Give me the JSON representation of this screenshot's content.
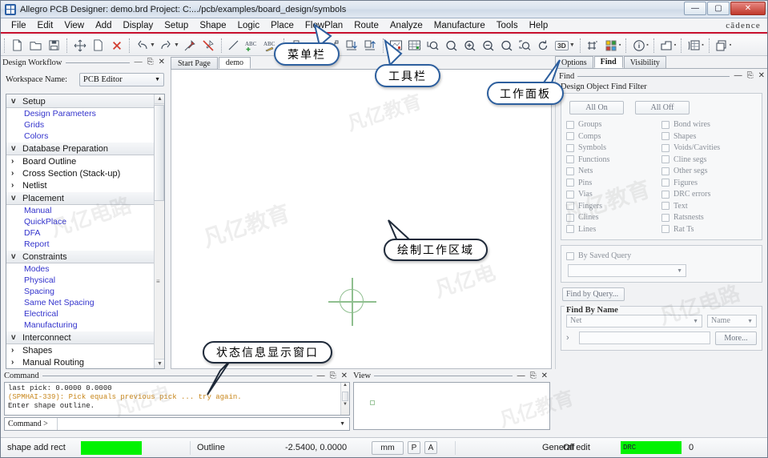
{
  "window": {
    "title": "Allegro PCB Designer: demo.brd  Project: C:.../pcb/examples/board_design/symbols",
    "minimize": "—",
    "maximize": "▢",
    "close": "✕",
    "brand": "cādence"
  },
  "menubar": {
    "items": [
      "File",
      "Edit",
      "View",
      "Add",
      "Display",
      "Setup",
      "Shape",
      "Logic",
      "Place",
      "FlowPlan",
      "Route",
      "Analyze",
      "Manufacture",
      "Tools",
      "Help"
    ]
  },
  "toolbar": {
    "icons": [
      "new-file-icon",
      "open-folder-icon",
      "save-icon",
      "move-icon",
      "copy-icon",
      "delete-icon",
      "undo-icon",
      "redo-icon",
      "pin-icon",
      "unpin-icon",
      "line-icon",
      "add-text-icon",
      "edit-text-icon",
      "component-icon",
      "placement-edit-icon",
      "dimension-icon",
      "import-icon",
      "export-icon",
      "datatips-icon",
      "grid-toggle-icon",
      "zoom-by-points-icon",
      "zoom-fit-icon",
      "zoom-in-icon",
      "zoom-out-icon",
      "zoom-previous-icon",
      "zoom-region-icon",
      "refresh-icon",
      "3d-view-icon",
      "grid-icon",
      "color-palette-icon",
      "info-icon",
      "shape-icon",
      "table-icon",
      "copy-window-icon"
    ],
    "label_3d": "3D"
  },
  "design_workflow": {
    "caption": "Design Workflow",
    "workspace_label": "Workspace Name:",
    "workspace_value": "PCB Editor",
    "tree": [
      {
        "type": "group",
        "label": "Setup",
        "twisty": "v"
      },
      {
        "type": "leaf",
        "label": "Design Parameters"
      },
      {
        "type": "leaf",
        "label": "Grids"
      },
      {
        "type": "leaf",
        "label": "Colors"
      },
      {
        "type": "group",
        "label": "Database Preparation",
        "twisty": "v"
      },
      {
        "type": "node",
        "label": "Board Outline",
        "twisty": "›"
      },
      {
        "type": "node",
        "label": "Cross Section (Stack-up)",
        "twisty": "›"
      },
      {
        "type": "node",
        "label": "Netlist",
        "twisty": "›"
      },
      {
        "type": "group",
        "label": "Placement",
        "twisty": "v"
      },
      {
        "type": "leaf",
        "label": "Manual"
      },
      {
        "type": "leaf",
        "label": "QuickPlace"
      },
      {
        "type": "leaf",
        "label": "DFA"
      },
      {
        "type": "leaf",
        "label": "Report"
      },
      {
        "type": "group",
        "label": "Constraints",
        "twisty": "v"
      },
      {
        "type": "leaf",
        "label": "Modes"
      },
      {
        "type": "leaf",
        "label": "Physical"
      },
      {
        "type": "leaf",
        "label": "Spacing"
      },
      {
        "type": "leaf",
        "label": "Same Net Spacing"
      },
      {
        "type": "leaf",
        "label": "Electrical"
      },
      {
        "type": "leaf",
        "label": "Manufacturing"
      },
      {
        "type": "group",
        "label": "Interconnect",
        "twisty": "v"
      },
      {
        "type": "node",
        "label": "Shapes",
        "twisty": "›"
      },
      {
        "type": "node",
        "label": "Manual Routing",
        "twisty": "›"
      }
    ]
  },
  "canvas_tabs": [
    {
      "label": "Start Page",
      "active": false
    },
    {
      "label": "demo",
      "active": true
    }
  ],
  "right_panel": {
    "tabs": [
      {
        "label": "Options",
        "active": false
      },
      {
        "label": "Find",
        "active": true
      },
      {
        "label": "Visibility",
        "active": false
      }
    ],
    "caption": "Find",
    "filter_title": "Design Object Find Filter",
    "all_on": "All On",
    "all_off": "All Off",
    "checkboxes_left": [
      "Groups",
      "Comps",
      "Symbols",
      "Functions",
      "Nets",
      "Pins",
      "Vias",
      "Fingers",
      "Clines",
      "Lines"
    ],
    "checkboxes_right": [
      "Bond wires",
      "Shapes",
      "Voids/Cavities",
      "Cline segs",
      "Other segs",
      "Figures",
      "DRC errors",
      "Text",
      "Ratsnests",
      "Rat Ts"
    ],
    "by_saved_query": "By Saved Query",
    "saved_query_value": "",
    "find_by_query": "Find by Query...",
    "find_by_name_title": "Find By Name",
    "object_type": "Net",
    "match_by": "Name",
    "name_value": "",
    "more_button": "More...",
    "expand_arrow": "›"
  },
  "command_panel": {
    "caption": "Command",
    "lines": [
      {
        "text": "last pick:  0.0000 0.0000",
        "color": "#222222"
      },
      {
        "text": "(SPMHAI-339): Pick equals previous pick ...  try again.",
        "color": "#c8861a"
      },
      {
        "text": "Enter shape outline.",
        "color": "#222222"
      }
    ],
    "prompt": "Command >",
    "input_value": ""
  },
  "view_panel": {
    "caption": "View"
  },
  "statusbar": {
    "command_name": "shape add rect",
    "progress_color": "#00f200",
    "mode": "Outline",
    "coords": "-2.5400, 0.0000",
    "units": "mm",
    "pick_flag": "P",
    "angle_flag": "A",
    "edit_mode": "General edit",
    "status_off": "Off",
    "drc_label": "DRC",
    "drc_count": "0"
  },
  "callouts": [
    {
      "name": "menubar-callout",
      "text": "菜单栏"
    },
    {
      "name": "toolbar-callout",
      "text": "工具栏"
    },
    {
      "name": "work-panel-callout",
      "text": "工作面板"
    },
    {
      "name": "drawing-area-callout",
      "text": "绘制工作区域"
    },
    {
      "name": "status-window-callout",
      "text": "状态信息显示窗口"
    }
  ],
  "watermarks": [
    "凡亿电路",
    "凡亿教育",
    "凡亿电",
    "凡亿教育"
  ]
}
